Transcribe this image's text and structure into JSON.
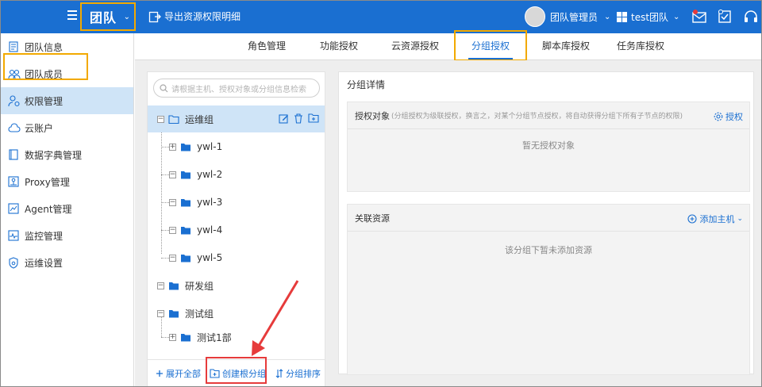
{
  "topbar": {
    "team_label": "团队",
    "export_label": "导出资源权限明细",
    "user_name": "团队管理员",
    "org_name": "test团队",
    "icons": [
      "mail-icon",
      "checklist-icon",
      "headset-icon"
    ]
  },
  "sidebar": {
    "items": [
      {
        "label": "团队信息",
        "icon": "document-icon"
      },
      {
        "label": "团队成员",
        "icon": "users-icon"
      },
      {
        "label": "权限管理",
        "icon": "user-permission-icon"
      },
      {
        "label": "云账户",
        "icon": "cloud-icon"
      },
      {
        "label": "数据字典管理",
        "icon": "book-icon"
      },
      {
        "label": "Proxy管理",
        "icon": "proxy-icon"
      },
      {
        "label": "Agent管理",
        "icon": "agent-icon"
      },
      {
        "label": "监控管理",
        "icon": "monitor-icon"
      },
      {
        "label": "运维设置",
        "icon": "shield-gear-icon"
      }
    ],
    "active_index": 2
  },
  "tabs": {
    "items": [
      "角色管理",
      "功能授权",
      "云资源授权",
      "分组授权",
      "脚本库授权",
      "任务库授权"
    ],
    "active_index": 3
  },
  "tree": {
    "search_placeholder": "请根据主机、授权对象或分组信息检索",
    "nodes": [
      {
        "label": "运维组",
        "expanded": true,
        "selected": true
      },
      {
        "label": "ywl-1",
        "expanded": false
      },
      {
        "label": "ywl-2",
        "expanded": true
      },
      {
        "label": "ywl-3",
        "expanded": true
      },
      {
        "label": "ywl-4",
        "expanded": true
      },
      {
        "label": "ywl-5",
        "expanded": true
      },
      {
        "label": "研发组",
        "expanded": true
      },
      {
        "label": "测试组",
        "expanded": true
      },
      {
        "label": "测试1部",
        "expanded": false
      }
    ],
    "footer": {
      "expand_all": "展开全部",
      "create_root": "创建根分组",
      "sort": "分组排序"
    }
  },
  "detail": {
    "title": "分组详情",
    "auth": {
      "title": "授权对象",
      "hint": "(分组授权为级联授权，换言之，对某个分组节点授权，将自动获得分组下所有子节点的权限)",
      "action": "授权",
      "empty": "暂无授权对象"
    },
    "resources": {
      "title": "关联资源",
      "action": "添加主机",
      "empty": "该分组下暂未添加资源"
    }
  },
  "colors": {
    "brand": "#1a6fd1",
    "highlight_orange": "#f2a900",
    "highlight_red": "#e63b3b",
    "selected_bg": "#cfe4f7"
  }
}
